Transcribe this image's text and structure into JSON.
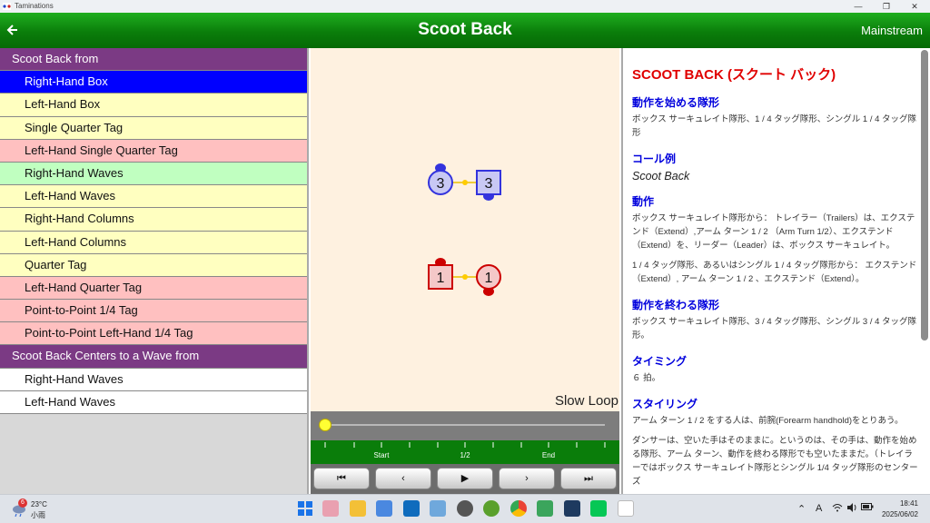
{
  "window": {
    "app_name": "Taminations",
    "minimize": "—",
    "restore": "❐",
    "close": "✕"
  },
  "header": {
    "back_icon": "arrow-left-icon",
    "title": "Scoot Back",
    "level": "Mainstream"
  },
  "left_list": {
    "sections": [
      {
        "header": "Scoot Back from",
        "items": [
          {
            "label": "Right-Hand Box",
            "color": "#0000ff"
          },
          {
            "label": "Left-Hand Box",
            "color": "#ffffc0"
          },
          {
            "label": "Single Quarter Tag",
            "color": "#ffffc0"
          },
          {
            "label": "Left-Hand Single Quarter Tag",
            "color": "#ffc0c0"
          },
          {
            "label": "Right-Hand Waves",
            "color": "#c0ffc0"
          },
          {
            "label": "Left-Hand Waves",
            "color": "#ffffc0"
          },
          {
            "label": "Right-Hand Columns",
            "color": "#ffffc0"
          },
          {
            "label": "Left-Hand Columns",
            "color": "#ffffc0"
          },
          {
            "label": "Quarter Tag",
            "color": "#ffffc0"
          },
          {
            "label": "Left-Hand Quarter Tag",
            "color": "#ffc0c0"
          },
          {
            "label": "Point-to-Point 1/4 Tag",
            "color": "#ffc0c0"
          },
          {
            "label": "Point-to-Point Left-Hand 1/4 Tag",
            "color": "#ffc0c0"
          }
        ]
      },
      {
        "header": "Scoot Back Centers to a Wave from",
        "items": [
          {
            "label": "Right-Hand Waves",
            "color": "#ffffff"
          },
          {
            "label": "Left-Hand Waves",
            "color": "#ffffff"
          }
        ]
      }
    ]
  },
  "animation": {
    "dancers": {
      "d3_circle": "3",
      "d3_square": "3",
      "d1_square": "1",
      "d1_circle": "1",
      "blue": "#3333dd",
      "blue_fill": "#c8c8f4",
      "red": "#cc0000",
      "red_fill": "#f4c8c8"
    },
    "slow_loop": "Slow Loop",
    "slider_position": 0,
    "tick_labels": {
      "start": "Start",
      "half": "1/2",
      "end": "End"
    },
    "controls": {
      "first": "⏮",
      "prev": "‹",
      "play": "▶",
      "next": "›",
      "last": "⏭"
    }
  },
  "description": {
    "title": "SCOOT BACK (スクート バック)",
    "sections": [
      {
        "heading": "動作を始める隊形",
        "text": "ボックス サーキュレイト隊形、1 / 4 タッグ隊形、シングル 1 / 4 タッグ隊形"
      },
      {
        "heading": "コール例",
        "text": "Scoot Back"
      },
      {
        "heading": "動作",
        "text": "ボックス サーキュレイト隊形から： トレイラー（Trailers）は、エクステンド（Extend）,アーム ターン 1 / 2 （Arm Turn 1/2）、エクステンド（Extend）を、リーダー（Leader）は、ボックス サーキュレイト。",
        "text2": "1 / 4 タッグ隊形、あるいはシングル 1 / 4 タッグ隊形から： エクステンド（Extend）, アーム ターン 1 / 2 、エクステンド（Extend）。"
      },
      {
        "heading": "動作を終わる隊形",
        "text": "ボックス サーキュレイト隊形、3 / 4 タッグ隊形、シングル 3 / 4 タッグ隊形。"
      },
      {
        "heading": "タイミング",
        "text": "６ 拍。"
      },
      {
        "heading": "スタイリング",
        "text": "アーム ターン 1 / 2 をする人は、前腕(Forearm handhold)をとりあう。",
        "text2": "ダンサーは、空いた手はそのままに。というのは、その手は、動作を始める隊形、アーム ターン、動作を終わる隊形でも空いたままだ。（トレイラーではボックス サーキュレイト隊形とシングル 1/4 タッグ隊形のセンターズ"
      }
    ]
  },
  "taskbar": {
    "weather": {
      "badge": "6",
      "temp": "23°C",
      "cond": "小雨"
    },
    "tray": {
      "chevron": "⌃",
      "ime": "A",
      "wifi": "wifi-icon",
      "volume": "volume-icon",
      "battery": "battery-icon"
    },
    "clock": {
      "time": "18:41",
      "date": "2025/06/02"
    }
  }
}
